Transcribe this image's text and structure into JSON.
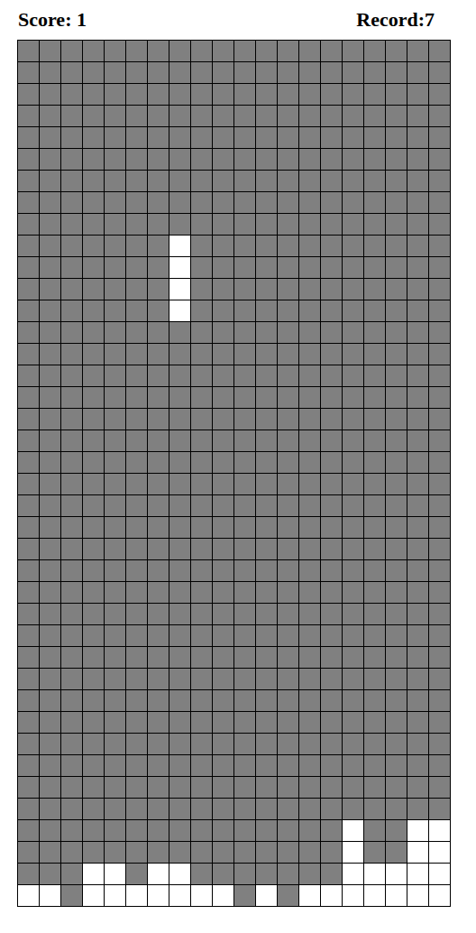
{
  "score": "Score: 1",
  "record": "Record:7",
  "grid": [
    [
      false,
      false,
      false,
      false,
      false,
      false,
      false,
      false,
      false,
      false,
      false,
      false,
      false,
      false,
      false,
      false,
      false,
      false,
      false,
      false
    ],
    [
      false,
      false,
      false,
      false,
      false,
      false,
      false,
      false,
      false,
      false,
      false,
      false,
      false,
      false,
      false,
      false,
      false,
      false,
      false,
      false
    ],
    [
      false,
      false,
      false,
      false,
      false,
      false,
      false,
      false,
      false,
      false,
      false,
      false,
      false,
      false,
      false,
      false,
      false,
      false,
      false,
      false
    ],
    [
      false,
      false,
      false,
      false,
      false,
      false,
      false,
      false,
      false,
      false,
      false,
      false,
      false,
      false,
      false,
      false,
      false,
      false,
      false,
      false
    ],
    [
      false,
      false,
      false,
      false,
      false,
      false,
      false,
      false,
      false,
      false,
      false,
      false,
      false,
      false,
      false,
      false,
      false,
      false,
      false,
      false
    ],
    [
      false,
      false,
      false,
      false,
      false,
      false,
      false,
      false,
      false,
      false,
      false,
      false,
      false,
      false,
      false,
      false,
      false,
      false,
      false,
      false
    ],
    [
      false,
      false,
      false,
      false,
      false,
      false,
      false,
      false,
      false,
      false,
      false,
      false,
      false,
      false,
      false,
      false,
      false,
      false,
      false,
      false
    ],
    [
      false,
      false,
      false,
      false,
      false,
      false,
      false,
      false,
      false,
      false,
      false,
      false,
      false,
      false,
      false,
      false,
      false,
      false,
      false,
      false
    ],
    [
      false,
      false,
      false,
      false,
      false,
      false,
      false,
      false,
      false,
      false,
      false,
      false,
      false,
      false,
      false,
      false,
      false,
      false,
      false,
      false
    ],
    [
      false,
      false,
      false,
      false,
      false,
      false,
      false,
      true,
      false,
      false,
      false,
      false,
      false,
      false,
      false,
      false,
      false,
      false,
      false,
      false
    ],
    [
      false,
      false,
      false,
      false,
      false,
      false,
      false,
      true,
      false,
      false,
      false,
      false,
      false,
      false,
      false,
      false,
      false,
      false,
      false,
      false
    ],
    [
      false,
      false,
      false,
      false,
      false,
      false,
      false,
      true,
      false,
      false,
      false,
      false,
      false,
      false,
      false,
      false,
      false,
      false,
      false,
      false
    ],
    [
      false,
      false,
      false,
      false,
      false,
      false,
      false,
      true,
      false,
      false,
      false,
      false,
      false,
      false,
      false,
      false,
      false,
      false,
      false,
      false
    ],
    [
      false,
      false,
      false,
      false,
      false,
      false,
      false,
      false,
      false,
      false,
      false,
      false,
      false,
      false,
      false,
      false,
      false,
      false,
      false,
      false
    ],
    [
      false,
      false,
      false,
      false,
      false,
      false,
      false,
      false,
      false,
      false,
      false,
      false,
      false,
      false,
      false,
      false,
      false,
      false,
      false,
      false
    ],
    [
      false,
      false,
      false,
      false,
      false,
      false,
      false,
      false,
      false,
      false,
      false,
      false,
      false,
      false,
      false,
      false,
      false,
      false,
      false,
      false
    ],
    [
      false,
      false,
      false,
      false,
      false,
      false,
      false,
      false,
      false,
      false,
      false,
      false,
      false,
      false,
      false,
      false,
      false,
      false,
      false,
      false
    ],
    [
      false,
      false,
      false,
      false,
      false,
      false,
      false,
      false,
      false,
      false,
      false,
      false,
      false,
      false,
      false,
      false,
      false,
      false,
      false,
      false
    ],
    [
      false,
      false,
      false,
      false,
      false,
      false,
      false,
      false,
      false,
      false,
      false,
      false,
      false,
      false,
      false,
      false,
      false,
      false,
      false,
      false
    ],
    [
      false,
      false,
      false,
      false,
      false,
      false,
      false,
      false,
      false,
      false,
      false,
      false,
      false,
      false,
      false,
      false,
      false,
      false,
      false,
      false
    ],
    [
      false,
      false,
      false,
      false,
      false,
      false,
      false,
      false,
      false,
      false,
      false,
      false,
      false,
      false,
      false,
      false,
      false,
      false,
      false,
      false
    ],
    [
      false,
      false,
      false,
      false,
      false,
      false,
      false,
      false,
      false,
      false,
      false,
      false,
      false,
      false,
      false,
      false,
      false,
      false,
      false,
      false
    ],
    [
      false,
      false,
      false,
      false,
      false,
      false,
      false,
      false,
      false,
      false,
      false,
      false,
      false,
      false,
      false,
      false,
      false,
      false,
      false,
      false
    ],
    [
      false,
      false,
      false,
      false,
      false,
      false,
      false,
      false,
      false,
      false,
      false,
      false,
      false,
      false,
      false,
      false,
      false,
      false,
      false,
      false
    ],
    [
      false,
      false,
      false,
      false,
      false,
      false,
      false,
      false,
      false,
      false,
      false,
      false,
      false,
      false,
      false,
      false,
      false,
      false,
      false,
      false
    ],
    [
      false,
      false,
      false,
      false,
      false,
      false,
      false,
      false,
      false,
      false,
      false,
      false,
      false,
      false,
      false,
      false,
      false,
      false,
      false,
      false
    ],
    [
      false,
      false,
      false,
      false,
      false,
      false,
      false,
      false,
      false,
      false,
      false,
      false,
      false,
      false,
      false,
      false,
      false,
      false,
      false,
      false
    ],
    [
      false,
      false,
      false,
      false,
      false,
      false,
      false,
      false,
      false,
      false,
      false,
      false,
      false,
      false,
      false,
      false,
      false,
      false,
      false,
      false
    ],
    [
      false,
      false,
      false,
      false,
      false,
      false,
      false,
      false,
      false,
      false,
      false,
      false,
      false,
      false,
      false,
      false,
      false,
      false,
      false,
      false
    ],
    [
      false,
      false,
      false,
      false,
      false,
      false,
      false,
      false,
      false,
      false,
      false,
      false,
      false,
      false,
      false,
      false,
      false,
      false,
      false,
      false
    ],
    [
      false,
      false,
      false,
      false,
      false,
      false,
      false,
      false,
      false,
      false,
      false,
      false,
      false,
      false,
      false,
      false,
      false,
      false,
      false,
      false
    ],
    [
      false,
      false,
      false,
      false,
      false,
      false,
      false,
      false,
      false,
      false,
      false,
      false,
      false,
      false,
      false,
      false,
      false,
      false,
      false,
      false
    ],
    [
      false,
      false,
      false,
      false,
      false,
      false,
      false,
      false,
      false,
      false,
      false,
      false,
      false,
      false,
      false,
      false,
      false,
      false,
      false,
      false
    ],
    [
      false,
      false,
      false,
      false,
      false,
      false,
      false,
      false,
      false,
      false,
      false,
      false,
      false,
      false,
      false,
      false,
      false,
      false,
      false,
      false
    ],
    [
      false,
      false,
      false,
      false,
      false,
      false,
      false,
      false,
      false,
      false,
      false,
      false,
      false,
      false,
      false,
      false,
      false,
      false,
      false,
      false
    ],
    [
      false,
      false,
      false,
      false,
      false,
      false,
      false,
      false,
      false,
      false,
      false,
      false,
      false,
      false,
      false,
      false,
      false,
      false,
      false,
      false
    ],
    [
      false,
      false,
      false,
      false,
      false,
      false,
      false,
      false,
      false,
      false,
      false,
      false,
      false,
      false,
      false,
      true,
      false,
      false,
      true,
      true
    ],
    [
      false,
      false,
      false,
      false,
      false,
      false,
      false,
      false,
      false,
      false,
      false,
      false,
      false,
      false,
      false,
      true,
      false,
      false,
      true,
      true
    ],
    [
      false,
      false,
      false,
      true,
      true,
      false,
      true,
      true,
      false,
      false,
      false,
      false,
      false,
      false,
      false,
      true,
      true,
      true,
      true,
      true
    ],
    [
      true,
      true,
      false,
      true,
      true,
      true,
      true,
      true,
      true,
      true,
      false,
      true,
      false,
      true,
      true,
      true,
      true,
      true,
      true,
      true
    ]
  ]
}
